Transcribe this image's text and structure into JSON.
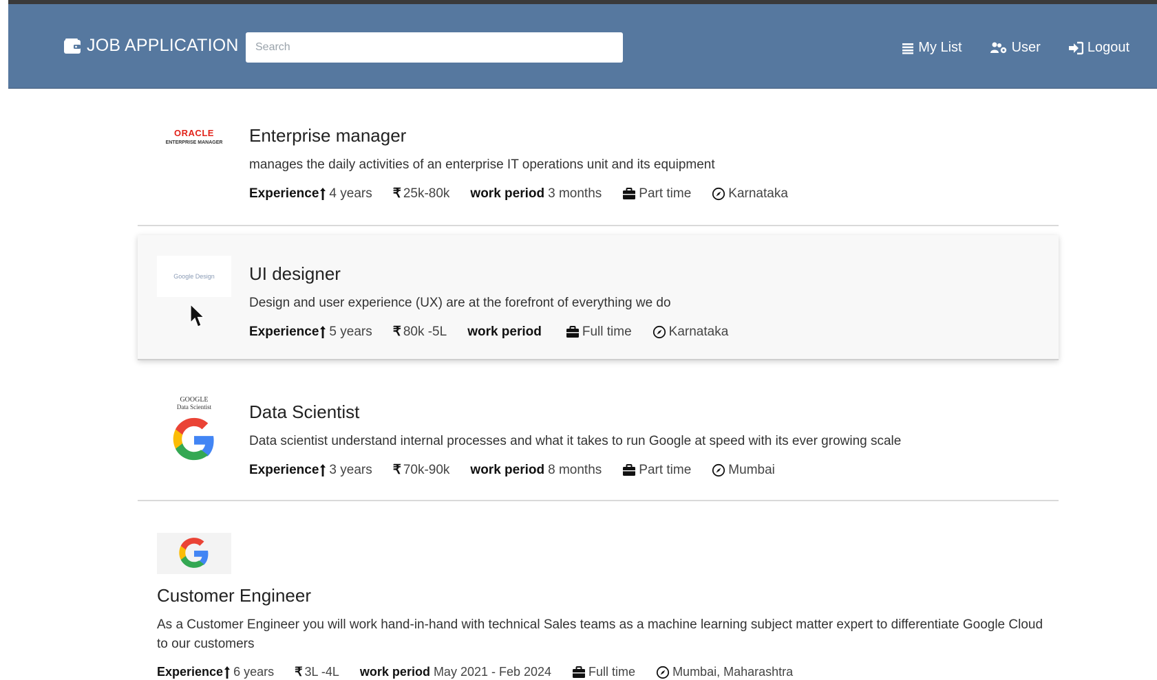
{
  "navbar": {
    "brand": "JOB APPLICATION",
    "search_placeholder": "Search",
    "links": [
      "My List",
      "User",
      "Logout"
    ]
  },
  "colors": {
    "navbar": "#56789f",
    "hover_bg": "#f8f8f8",
    "divider": "#d9d9d9"
  },
  "jobs": [
    {
      "logo_brand": "ORACLE",
      "logo_sub": "ENTERPRISE MANAGER",
      "title": "Enterprise manager",
      "description": "manages the daily activities of an enterprise IT operations unit and its equipment",
      "experience_label": "Experience",
      "experience": "4 years",
      "salary": "25k-80k",
      "work_period_label": "work period",
      "work_period": "3 months",
      "type": "Part time",
      "location": "Karnataka"
    },
    {
      "logo_text": "Google Design",
      "title": "UI designer",
      "description": "Design and user experience (UX) are at the forefront of everything we do",
      "experience_label": "Experience",
      "experience": "5 years",
      "salary": "80k -5L",
      "work_period_label": "work period",
      "work_period": "",
      "type": "Full time",
      "location": "Karnataka"
    },
    {
      "logo_line1": "GOOGLE",
      "logo_line2": "Data Scientist",
      "title": "Data Scientist",
      "description": "Data scientist understand internal processes and what it takes to run Google at speed with its ever growing scale",
      "experience_label": "Experience",
      "experience": "3 years",
      "salary": "70k-90k",
      "work_period_label": "work period",
      "work_period": "8 months",
      "type": "Part time",
      "location": "Mumbai"
    },
    {
      "title": "Customer Engineer",
      "description": "As a Customer Engineer you will work hand-in-hand with technical Sales teams as a machine learning subject matter expert to differentiate Google Cloud to our customers",
      "experience_label": "Experience",
      "experience": "6 years",
      "salary": "3L -4L",
      "work_period_label": "work period",
      "work_period": "May 2021 - Feb 2024",
      "type": "Full time",
      "location": "Mumbai, Maharashtra"
    }
  ]
}
